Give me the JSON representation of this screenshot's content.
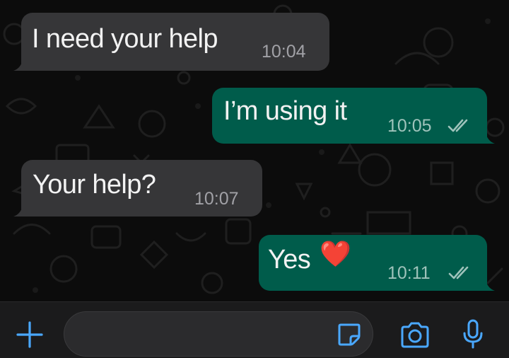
{
  "messages": [
    {
      "direction": "incoming",
      "text": "I need your help",
      "time": "10:04"
    },
    {
      "direction": "outgoing",
      "text": "I’m using it",
      "time": "10:05",
      "status": "read"
    },
    {
      "direction": "incoming",
      "text": "Your help?",
      "time": "10:07"
    },
    {
      "direction": "outgoing",
      "text": "Yes",
      "emoji": "❤️",
      "time": "10:11",
      "status": "read"
    }
  ],
  "input_bar": {
    "icons": [
      "plus-icon",
      "sticker-icon",
      "camera-icon",
      "microphone-icon"
    ],
    "accent_color": "#4aa8ff"
  },
  "colors": {
    "incoming_bubble": "#363638",
    "outgoing_bubble": "#005c4b",
    "background": "#0c0c0c"
  }
}
